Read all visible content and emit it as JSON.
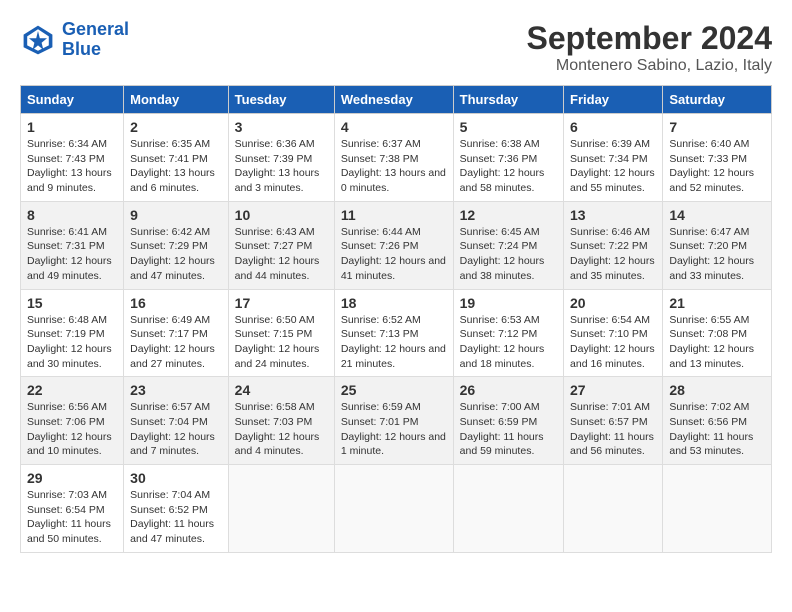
{
  "header": {
    "logo_line1": "General",
    "logo_line2": "Blue",
    "title": "September 2024",
    "subtitle": "Montenero Sabino, Lazio, Italy"
  },
  "weekdays": [
    "Sunday",
    "Monday",
    "Tuesday",
    "Wednesday",
    "Thursday",
    "Friday",
    "Saturday"
  ],
  "weeks": [
    [
      {
        "day": "1",
        "sunrise": "6:34 AM",
        "sunset": "7:43 PM",
        "daylight": "13 hours and 9 minutes."
      },
      {
        "day": "2",
        "sunrise": "6:35 AM",
        "sunset": "7:41 PM",
        "daylight": "13 hours and 6 minutes."
      },
      {
        "day": "3",
        "sunrise": "6:36 AM",
        "sunset": "7:39 PM",
        "daylight": "13 hours and 3 minutes."
      },
      {
        "day": "4",
        "sunrise": "6:37 AM",
        "sunset": "7:38 PM",
        "daylight": "13 hours and 0 minutes."
      },
      {
        "day": "5",
        "sunrise": "6:38 AM",
        "sunset": "7:36 PM",
        "daylight": "12 hours and 58 minutes."
      },
      {
        "day": "6",
        "sunrise": "6:39 AM",
        "sunset": "7:34 PM",
        "daylight": "12 hours and 55 minutes."
      },
      {
        "day": "7",
        "sunrise": "6:40 AM",
        "sunset": "7:33 PM",
        "daylight": "12 hours and 52 minutes."
      }
    ],
    [
      {
        "day": "8",
        "sunrise": "6:41 AM",
        "sunset": "7:31 PM",
        "daylight": "12 hours and 49 minutes."
      },
      {
        "day": "9",
        "sunrise": "6:42 AM",
        "sunset": "7:29 PM",
        "daylight": "12 hours and 47 minutes."
      },
      {
        "day": "10",
        "sunrise": "6:43 AM",
        "sunset": "7:27 PM",
        "daylight": "12 hours and 44 minutes."
      },
      {
        "day": "11",
        "sunrise": "6:44 AM",
        "sunset": "7:26 PM",
        "daylight": "12 hours and 41 minutes."
      },
      {
        "day": "12",
        "sunrise": "6:45 AM",
        "sunset": "7:24 PM",
        "daylight": "12 hours and 38 minutes."
      },
      {
        "day": "13",
        "sunrise": "6:46 AM",
        "sunset": "7:22 PM",
        "daylight": "12 hours and 35 minutes."
      },
      {
        "day": "14",
        "sunrise": "6:47 AM",
        "sunset": "7:20 PM",
        "daylight": "12 hours and 33 minutes."
      }
    ],
    [
      {
        "day": "15",
        "sunrise": "6:48 AM",
        "sunset": "7:19 PM",
        "daylight": "12 hours and 30 minutes."
      },
      {
        "day": "16",
        "sunrise": "6:49 AM",
        "sunset": "7:17 PM",
        "daylight": "12 hours and 27 minutes."
      },
      {
        "day": "17",
        "sunrise": "6:50 AM",
        "sunset": "7:15 PM",
        "daylight": "12 hours and 24 minutes."
      },
      {
        "day": "18",
        "sunrise": "6:52 AM",
        "sunset": "7:13 PM",
        "daylight": "12 hours and 21 minutes."
      },
      {
        "day": "19",
        "sunrise": "6:53 AM",
        "sunset": "7:12 PM",
        "daylight": "12 hours and 18 minutes."
      },
      {
        "day": "20",
        "sunrise": "6:54 AM",
        "sunset": "7:10 PM",
        "daylight": "12 hours and 16 minutes."
      },
      {
        "day": "21",
        "sunrise": "6:55 AM",
        "sunset": "7:08 PM",
        "daylight": "12 hours and 13 minutes."
      }
    ],
    [
      {
        "day": "22",
        "sunrise": "6:56 AM",
        "sunset": "7:06 PM",
        "daylight": "12 hours and 10 minutes."
      },
      {
        "day": "23",
        "sunrise": "6:57 AM",
        "sunset": "7:04 PM",
        "daylight": "12 hours and 7 minutes."
      },
      {
        "day": "24",
        "sunrise": "6:58 AM",
        "sunset": "7:03 PM",
        "daylight": "12 hours and 4 minutes."
      },
      {
        "day": "25",
        "sunrise": "6:59 AM",
        "sunset": "7:01 PM",
        "daylight": "12 hours and 1 minute."
      },
      {
        "day": "26",
        "sunrise": "7:00 AM",
        "sunset": "6:59 PM",
        "daylight": "11 hours and 59 minutes."
      },
      {
        "day": "27",
        "sunrise": "7:01 AM",
        "sunset": "6:57 PM",
        "daylight": "11 hours and 56 minutes."
      },
      {
        "day": "28",
        "sunrise": "7:02 AM",
        "sunset": "6:56 PM",
        "daylight": "11 hours and 53 minutes."
      }
    ],
    [
      {
        "day": "29",
        "sunrise": "7:03 AM",
        "sunset": "6:54 PM",
        "daylight": "11 hours and 50 minutes."
      },
      {
        "day": "30",
        "sunrise": "7:04 AM",
        "sunset": "6:52 PM",
        "daylight": "11 hours and 47 minutes."
      },
      null,
      null,
      null,
      null,
      null
    ]
  ]
}
